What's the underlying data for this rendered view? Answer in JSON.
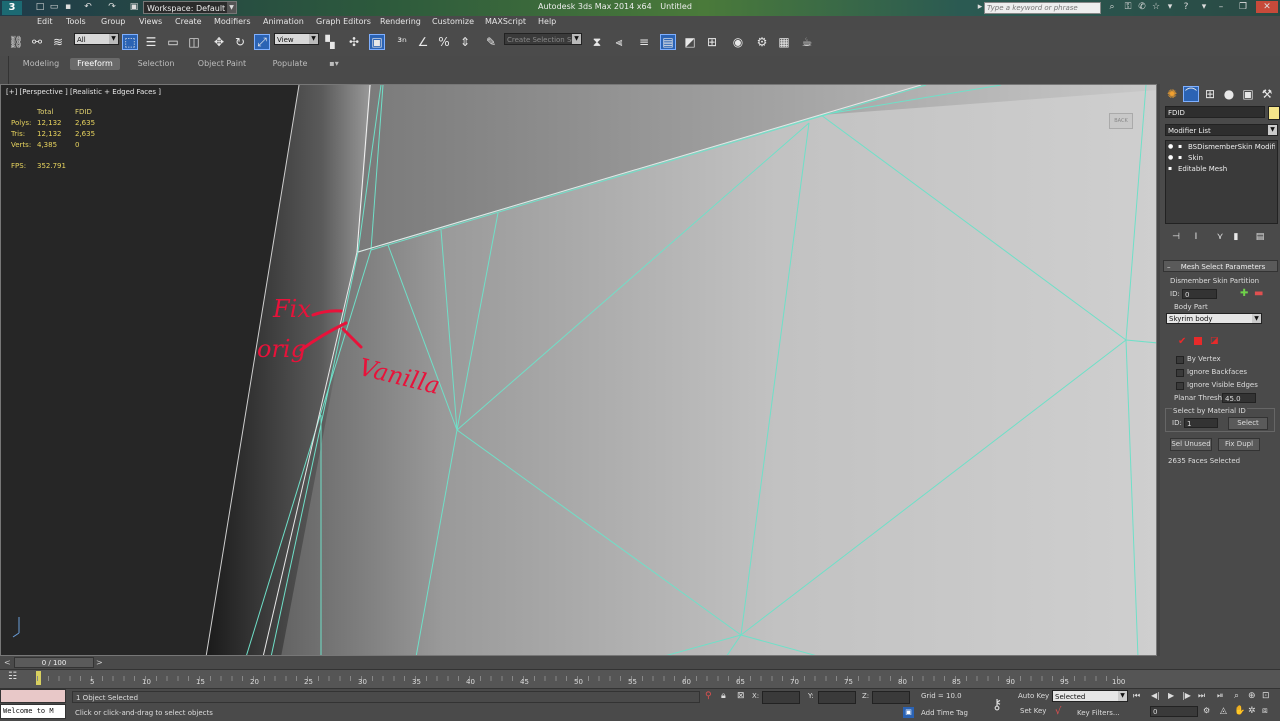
{
  "titlebar": {
    "workspace": "Workspace: Default",
    "app_title": "Autodesk 3ds Max 2014 x64",
    "doc_title": "Untitled",
    "search_placeholder": "Type a keyword or phrase"
  },
  "menu": [
    "Edit",
    "Tools",
    "Group",
    "Views",
    "Create",
    "Modifiers",
    "Animation",
    "Graph Editors",
    "Rendering",
    "Customize",
    "MAXScript",
    "Help"
  ],
  "toolbar": {
    "filter_value": "All",
    "refcoord_value": "View",
    "named_selection_value": "Create Selection Se"
  },
  "ribbon": {
    "tabs": [
      "Modeling",
      "Freeform",
      "Selection",
      "Object Paint",
      "Populate"
    ],
    "active_tab": "Freeform"
  },
  "viewport": {
    "label": "[+] [Perspective ] [Realistic + Edged Faces ]",
    "stats_header": [
      "Total",
      "FDID"
    ],
    "stats": [
      {
        "label": "Polys:",
        "total": "12,132",
        "sel": "2,635"
      },
      {
        "label": "Tris:",
        "total": "12,132",
        "sel": "2,635"
      },
      {
        "label": "Verts:",
        "total": "4,385",
        "sel": "0"
      }
    ],
    "fps_label": "FPS:",
    "fps_value": "352.791",
    "viewcube_label": "BACK",
    "annotations": {
      "fix": "Fix",
      "orig": "orig",
      "vanilla": "Vanilla"
    },
    "colors": {
      "edge": "#6fe0c8",
      "annotation": "#e8123a"
    }
  },
  "command_panel": {
    "object_name": "FDID",
    "modifier_list_label": "Modifier List",
    "stack": [
      "BSDismemberSkin Modifie",
      "Skin",
      "Editable Mesh"
    ],
    "rollout_title": "Mesh Select Parameters",
    "partition_group": "Dismember Skin Partition",
    "id_label": "ID:",
    "id_value": "0",
    "body_part_label": "Body Part",
    "body_part_value": "Skyrim body",
    "checkboxes": [
      "By Vertex",
      "Ignore Backfaces",
      "Ignore Visible Edges"
    ],
    "planar_label": "Planar Thresh:",
    "planar_value": "45.0",
    "select_by_material": "Select by Material ID",
    "mat_id_value": "1",
    "select_button": "Select",
    "sel_unused_button": "Sel Unused",
    "fix_dupl_button": "Fix Dupl",
    "faces_selected": "2635 Faces Selected"
  },
  "timeline": {
    "frame_display": "0 / 100",
    "ticks": [
      "5",
      "10",
      "15",
      "20",
      "25",
      "30",
      "35",
      "40",
      "45",
      "50",
      "55",
      "60",
      "65",
      "70",
      "75",
      "80",
      "85",
      "90",
      "95",
      "100"
    ]
  },
  "statusbar": {
    "script_listener": "Welcome to M",
    "selection_status": "1 Object Selected",
    "prompt": "Click or click-and-drag to select objects",
    "x_label": "X:",
    "y_label": "Y:",
    "z_label": "Z:",
    "grid": "Grid = 10.0",
    "add_time_tag": "Add Time Tag",
    "auto_key": "Auto Key",
    "set_key": "Set Key",
    "key_mode_value": "Selected",
    "key_filters": "Key Filters...",
    "current_frame": "0"
  }
}
